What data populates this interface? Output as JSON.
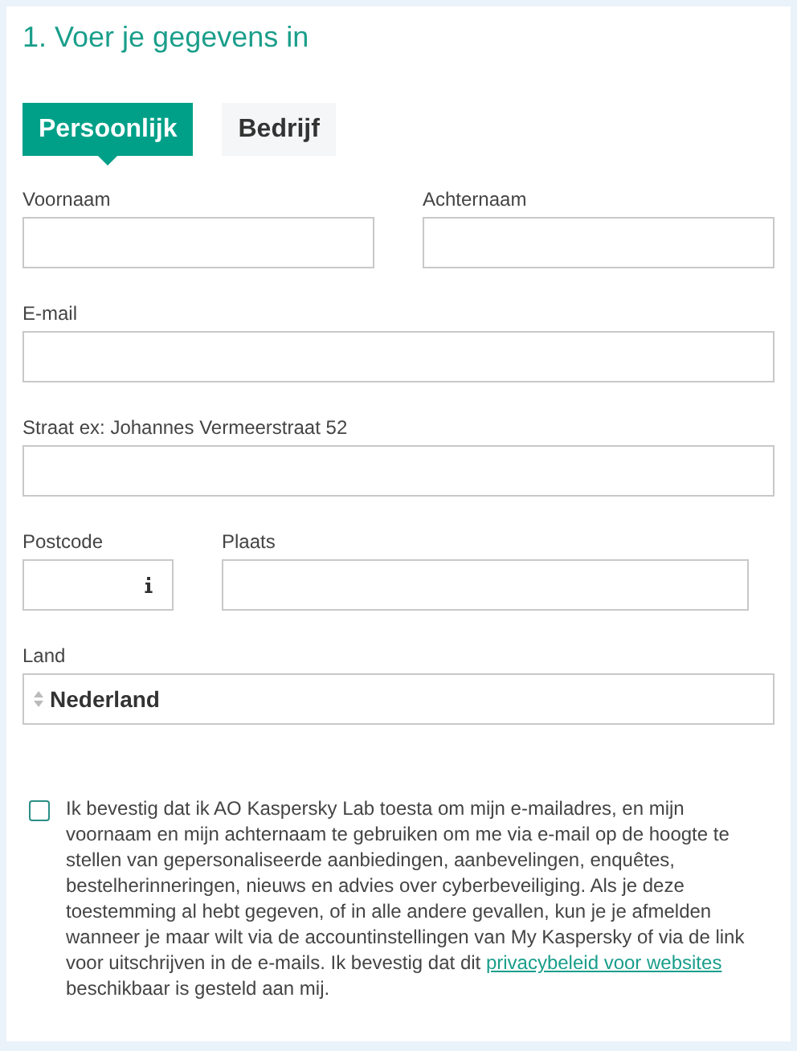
{
  "title": "1. Voer je gegevens in",
  "tabs": [
    {
      "label": "Persoonlijk",
      "selected": true
    },
    {
      "label": "Bedrijf",
      "selected": false
    }
  ],
  "rows": [
    [
      {
        "label": "Voornaam",
        "kind": "text"
      },
      {
        "label": "Achternaam",
        "kind": "text"
      }
    ],
    [
      {
        "label": "E-mail",
        "kind": "text"
      }
    ],
    [
      {
        "label": "Straat ex: Johannes Vermeerstraat 52",
        "kind": "text"
      }
    ],
    [
      {
        "label": "Postcode",
        "kind": "info"
      },
      {
        "label": "Plaats",
        "kind": "text"
      }
    ],
    [
      {
        "label": "Land",
        "kind": "select",
        "value": "Nederland"
      }
    ]
  ],
  "consent": {
    "checked": false,
    "text_before": "Ik bevestig dat ik AO Kaspersky Lab toesta om mijn e-mailadres, en mijn voornaam en mijn achternaam te gebruiken om me via e-mail op de hoogte te stellen van gepersonaliseerde aanbiedingen, aanbevelingen, enquêtes, bestelherinneringen, nieuws en advies over cyberbeveiliging. Als je deze toestemming al hebt gegeven, of in alle andere gevallen, kun je je afmelden wanneer je maar wilt via de accountinstellingen van My Kaspersky of via de link voor uitschrijven in de e-mails. Ik bevestig dat dit",
    "link": "privacybeleid voor websites",
    "text_after": "beschikbaar is gesteld aan mij."
  }
}
